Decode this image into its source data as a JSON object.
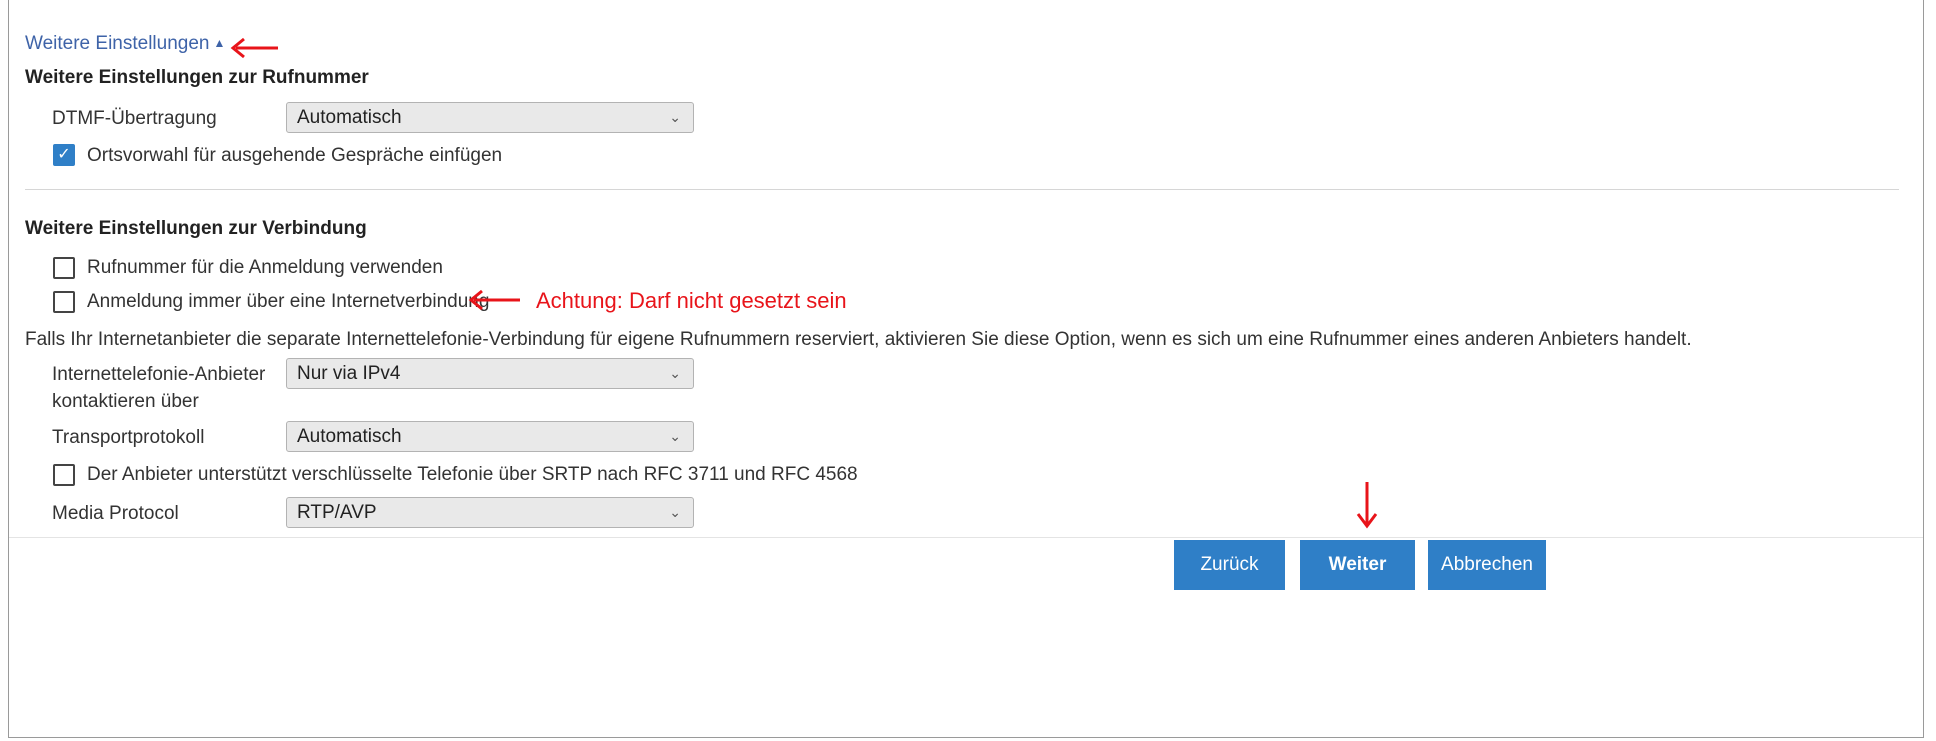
{
  "toggle": {
    "label": "Weitere Einstellungen",
    "caret": "▲"
  },
  "section_number": {
    "title": "Weitere Einstellungen zur Rufnummer",
    "dtmf_label": "DTMF-Übertragung",
    "dtmf_value": "Automatisch",
    "area_code_label": "Ortsvorwahl für ausgehende Gespräche einfügen",
    "area_code_checked": true
  },
  "section_connection": {
    "title": "Weitere Einstellungen zur Verbindung",
    "use_number_label": "Rufnummer für die Anmeldung verwenden",
    "always_internet_label": "Anmeldung immer über eine Internetverbindung",
    "note": "Falls Ihr Internetanbieter die separate Internettelefonie-Verbindung für eigene Rufnummern reserviert, aktivieren Sie diese Option, wenn es sich um eine Rufnummer eines anderen Anbieters handelt.",
    "contact_label_line1": "Internettelefonie-Anbieter",
    "contact_label_line2": "kontaktieren über",
    "contact_value": "Nur via IPv4",
    "transport_label": "Transportprotokoll",
    "transport_value": "Automatisch",
    "srtp_label": "Der Anbieter unterstützt verschlüsselte Telefonie über SRTP nach RFC 3711 und RFC 4568",
    "media_label": "Media Protocol",
    "media_value": "RTP/AVP"
  },
  "annotation": {
    "warning": "Achtung: Darf nicht gesetzt sein",
    "accent_color": "#e8141a"
  },
  "buttons": {
    "back": "Zurück",
    "next": "Weiter",
    "cancel": "Abbrechen"
  },
  "colors": {
    "button": "#2f7fc7",
    "link": "#3e63a8",
    "checkbox": "#2f7fc7"
  }
}
